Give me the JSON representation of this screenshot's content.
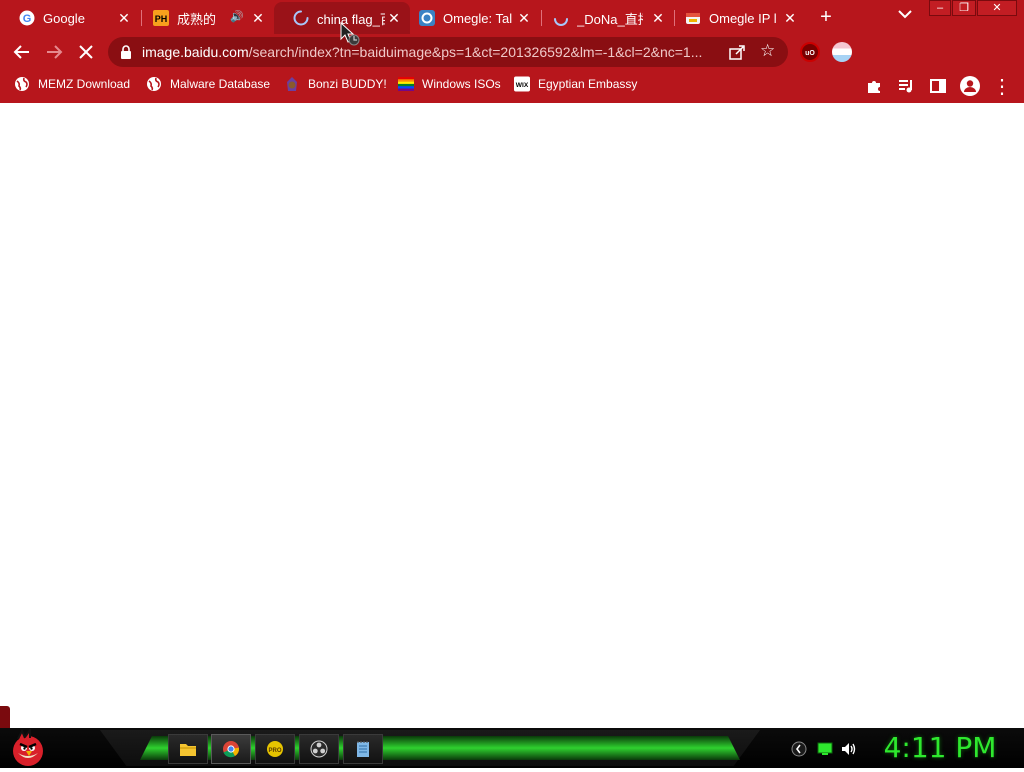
{
  "tabs": [
    {
      "title": "Google",
      "favicon": "google-icon",
      "active": false
    },
    {
      "title": "成熟的",
      "favicon": "ph-icon",
      "active": false,
      "audio": true
    },
    {
      "title": "china flag_百",
      "favicon": "loading-spinner-icon",
      "active": true
    },
    {
      "title": "Omegle: Talk",
      "favicon": "omegle-icon",
      "active": false
    },
    {
      "title": "_DoNa_直播",
      "favicon": "loading-spinner-icon",
      "active": false
    },
    {
      "title": "Omegle IP lo",
      "favicon": "omegle-ip-icon",
      "active": false
    }
  ],
  "tab_close_glyph": "✕",
  "new_tab_glyph": "+",
  "window_controls": {
    "minimize": "–",
    "restore": "❐",
    "close": "✕"
  },
  "toolbar": {
    "back_glyph": "←",
    "forward_glyph": "→",
    "stop_glyph": "✕",
    "url_host": "image.baidu.com",
    "url_path": "/search/index?tn=baiduimage&ps=1&ct=201326592&lm=-1&cl=2&nc=1...",
    "star_glyph": "☆",
    "menu_glyph": "⋮"
  },
  "extensions": [
    "ublock-origin-icon",
    "vpn-icon",
    "puzzle-extensions-icon",
    "media-queue-icon",
    "side-panel-icon",
    "profile-icon"
  ],
  "bookmarks": [
    {
      "label": "MEMZ Download",
      "icon": "globe-icon"
    },
    {
      "label": "Malware Database",
      "icon": "globe-icon"
    },
    {
      "label": "Bonzi BUDDY!",
      "icon": "bonzi-icon"
    },
    {
      "label": "Windows ISOs",
      "icon": "rainbow-flag-icon"
    },
    {
      "label": "Egyptian Embassy",
      "icon": "wix-icon"
    }
  ],
  "taskbar": {
    "start_icon": "angry-bird-start-icon",
    "apps": [
      "file-explorer-icon",
      "chrome-icon",
      "bonzi-pro-icon",
      "obs-icon",
      "notepad-icon"
    ],
    "tray": [
      "keyboard-layout-icon",
      "network-icon",
      "volume-icon"
    ],
    "clock": "4:11 PM"
  },
  "colors": {
    "chrome_red": "#b7161c",
    "active_tab": "#9a1218",
    "omnibox": "#8a0e12",
    "clock_green": "#2ee82e",
    "taskbar_green": "#2fd12f"
  }
}
